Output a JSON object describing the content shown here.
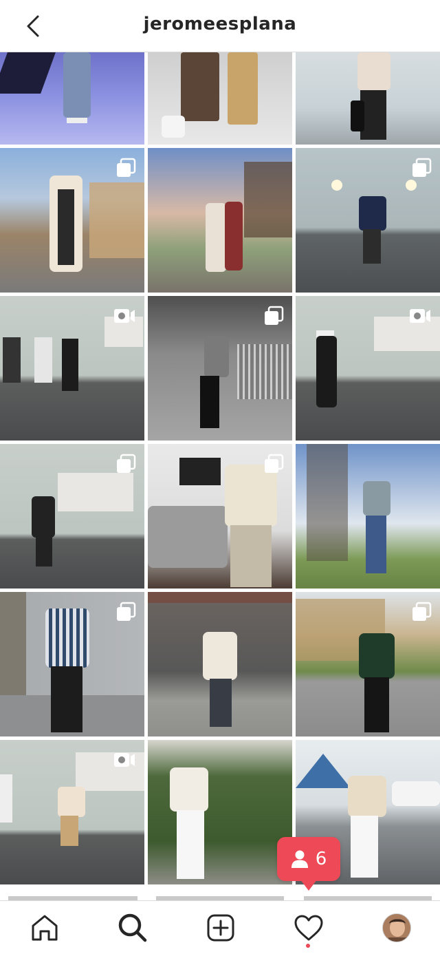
{
  "header": {
    "title": "jeromeesplana",
    "back_icon": "chevron-left-icon"
  },
  "grid": {
    "posts": [
      {
        "type": "photo"
      },
      {
        "type": "photo"
      },
      {
        "type": "photo"
      },
      {
        "type": "carousel"
      },
      {
        "type": "photo"
      },
      {
        "type": "carousel"
      },
      {
        "type": "reel"
      },
      {
        "type": "carousel"
      },
      {
        "type": "reel"
      },
      {
        "type": "carousel"
      },
      {
        "type": "carousel"
      },
      {
        "type": "photo"
      },
      {
        "type": "carousel"
      },
      {
        "type": "photo"
      },
      {
        "type": "carousel"
      },
      {
        "type": "reel"
      },
      {
        "type": "photo"
      },
      {
        "type": "photo"
      }
    ]
  },
  "notification": {
    "icon": "person-icon",
    "count": "6",
    "color": "#ed4956"
  },
  "tabbar": {
    "items": [
      "home-icon",
      "search-icon",
      "new-post-icon",
      "heart-icon",
      "profile-avatar"
    ],
    "active": "search-icon"
  }
}
